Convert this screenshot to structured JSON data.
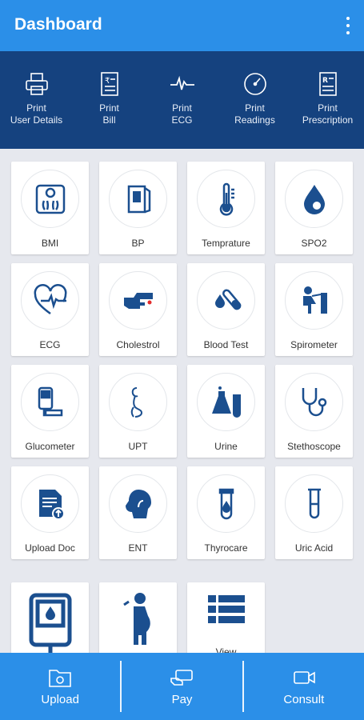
{
  "header": {
    "title": "Dashboard",
    "menu_icon": "more-vert-icon"
  },
  "print_bar": {
    "items": [
      {
        "label": "Print\nUser Details",
        "icon": "printer-icon"
      },
      {
        "label": "Print\nBill",
        "icon": "bill-icon"
      },
      {
        "label": "Print\nECG",
        "icon": "ecg-wave-icon"
      },
      {
        "label": "Print\nReadings",
        "icon": "gauge-icon"
      },
      {
        "label": "Print\nPrescription",
        "icon": "prescription-icon"
      }
    ]
  },
  "tiles": [
    {
      "label": "BMI",
      "icon": "scale-icon"
    },
    {
      "label": "BP",
      "icon": "bp-monitor-icon"
    },
    {
      "label": "Temprature",
      "icon": "thermometer-icon"
    },
    {
      "label": "SPO2",
      "icon": "oxygen-drop-icon"
    },
    {
      "label": "ECG",
      "icon": "heart-ecg-icon"
    },
    {
      "label": "Cholestrol",
      "icon": "finger-prick-icon"
    },
    {
      "label": "Blood Test",
      "icon": "test-tube-icon"
    },
    {
      "label": "Spirometer",
      "icon": "spirometer-icon"
    },
    {
      "label": "Glucometer",
      "icon": "glucometer-icon"
    },
    {
      "label": "UPT",
      "icon": "pregnancy-icon"
    },
    {
      "label": "Urine",
      "icon": "flask-icon"
    },
    {
      "label": "Stethoscope",
      "icon": "stethoscope-icon"
    },
    {
      "label": "Upload Doc",
      "icon": "upload-doc-icon"
    },
    {
      "label": "ENT",
      "icon": "ent-icon"
    },
    {
      "label": "Thyrocare",
      "icon": "thyrocare-tube-icon"
    },
    {
      "label": "Uric Acid",
      "icon": "vial-icon"
    },
    {
      "label": "",
      "icon": "glucose-meter-icon"
    },
    {
      "label": "",
      "icon": "pregnant-woman-icon"
    },
    {
      "label": "View",
      "icon": "list-view-icon"
    }
  ],
  "bottom_bar": {
    "items": [
      {
        "label": "Upload",
        "icon": "upload-folder-icon"
      },
      {
        "label": "Pay",
        "icon": "pay-icon"
      },
      {
        "label": "Consult",
        "icon": "video-call-icon"
      }
    ]
  },
  "colors": {
    "primary": "#2b8fe8",
    "dark": "#15427f",
    "icon": "#1b4f8f",
    "background": "#e6e8ee"
  }
}
